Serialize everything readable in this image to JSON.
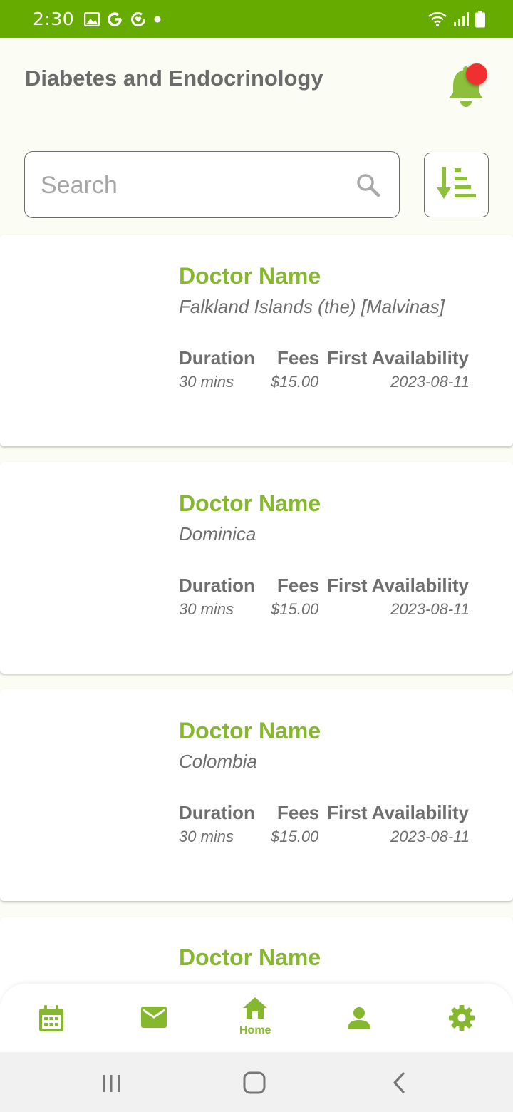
{
  "status_bar": {
    "time": "2:30"
  },
  "header": {
    "title": "Diabetes and Endocrinology"
  },
  "search": {
    "placeholder": "Search",
    "value": ""
  },
  "colors": {
    "accent": "#86b82f",
    "status_bar": "#66ab00",
    "notification_dot": "#f03030",
    "text": "#6e6e6e"
  },
  "column_headers": {
    "duration": "Duration",
    "fees": "Fees",
    "first_availability": "First Availability"
  },
  "doctors": [
    {
      "name": "Doctor Name",
      "country": "Falkland Islands (the) [Malvinas]",
      "duration": "30 mins",
      "fees": "$15.00",
      "first_availability": "2023-08-11"
    },
    {
      "name": "Doctor Name",
      "country": "Dominica",
      "duration": "30 mins",
      "fees": "$15.00",
      "first_availability": "2023-08-11"
    },
    {
      "name": "Doctor Name",
      "country": "Colombia",
      "duration": "30 mins",
      "fees": "$15.00",
      "first_availability": "2023-08-11"
    },
    {
      "name": "Doctor Name",
      "country": "",
      "duration": "",
      "fees": "",
      "first_availability": ""
    }
  ],
  "bottom_nav": {
    "items": [
      {
        "icon": "calendar-icon",
        "label": ""
      },
      {
        "icon": "mail-icon",
        "label": ""
      },
      {
        "icon": "home-icon",
        "label": "Home"
      },
      {
        "icon": "person-icon",
        "label": ""
      },
      {
        "icon": "gear-icon",
        "label": ""
      }
    ]
  }
}
